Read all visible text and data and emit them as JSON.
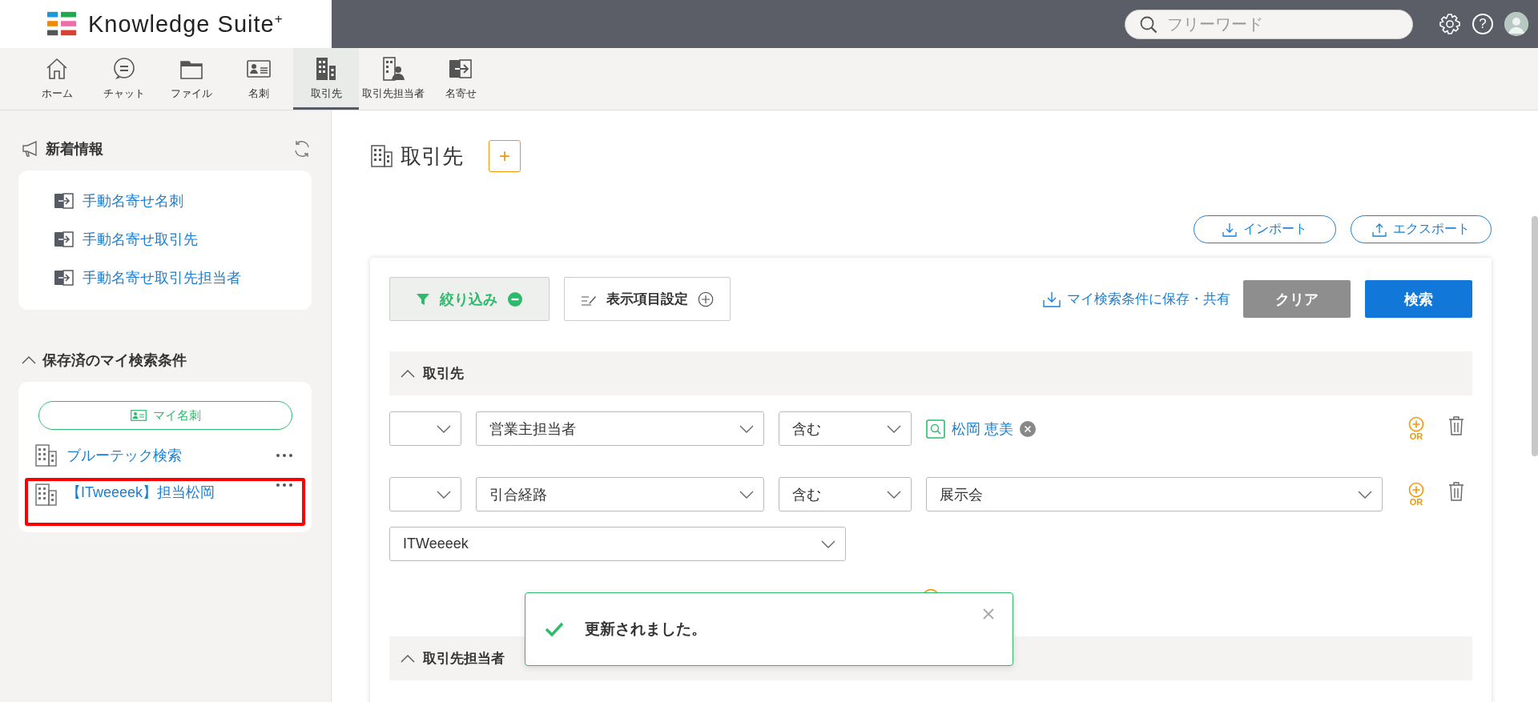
{
  "header": {
    "logo_text": "Knowledge Suite$^{+}$",
    "search": {
      "placeholder": "フリーワード"
    },
    "help_label": "?"
  },
  "nav": [
    {
      "label": "ホーム",
      "selected": false
    },
    {
      "label": "チャット",
      "selected": false
    },
    {
      "label": "ファイル",
      "selected": false
    },
    {
      "label": "名刺",
      "selected": false
    },
    {
      "label": "取引先",
      "selected": true
    },
    {
      "label": "取引先担当者",
      "selected": false
    },
    {
      "label": "名寄せ",
      "selected": false
    }
  ],
  "sidebar": {
    "news": {
      "title": "新着情報",
      "items": [
        "手動名寄せ名刺",
        "手動名寄せ取引先",
        "手動名寄せ取引先担当者"
      ]
    },
    "saved": {
      "title": "保存済のマイ検索条件",
      "expanded": true,
      "my_card_button": "マイ名刺",
      "items": [
        {
          "label": "ブルーテック検索",
          "highlighted": false
        },
        {
          "label": "【ITweeeek】担当松岡",
          "highlighted": true
        }
      ]
    }
  },
  "main": {
    "title": "取引先",
    "add_button": "+",
    "import_button": "インポート",
    "export_button": "エクスポート",
    "toolbar": [
      {
        "kind": "filter",
        "label": "絞り込み",
        "expanded": true
      },
      {
        "kind": "columns",
        "label": "表示項目設定",
        "expanded": false
      },
      {
        "kind": "save-link",
        "label": "マイ検索条件に保存・共有"
      },
      {
        "kind": "clear",
        "label": "クリア"
      },
      {
        "kind": "search",
        "label": "検索"
      }
    ],
    "sections": [
      {
        "title": "取引先",
        "expanded": true,
        "conditions": [
          {
            "kind": "person",
            "field": "営業主担当者",
            "operator": "含む",
            "value": "松岡 恵美",
            "or_label": "OR"
          },
          {
            "kind": "select",
            "field": "引合経路",
            "operator": "含む",
            "value": "展示会",
            "sub_value": "ITWeeeek",
            "or_label": "OR"
          }
        ]
      },
      {
        "title": "取引先担当者",
        "expanded": true
      }
    ]
  },
  "toast": {
    "kind": "success",
    "message": "更新されました。"
  }
}
